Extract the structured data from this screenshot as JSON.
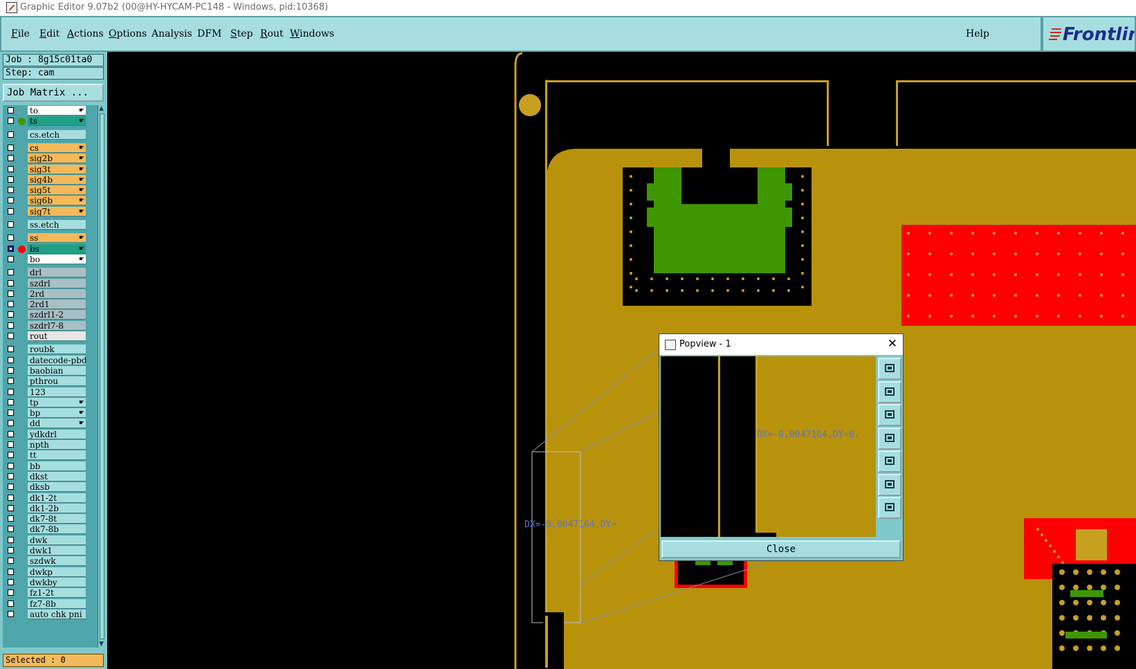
{
  "window": {
    "title": "Graphic Editor 9.07b2 (00@HY-HYCAM-PC148 - Windows, pid:10368)"
  },
  "menu": {
    "items": [
      {
        "label": "File",
        "hot": "F",
        "rest": "ile"
      },
      {
        "label": "Edit",
        "hot": "E",
        "rest": "dit"
      },
      {
        "label": "Actions",
        "hot": "A",
        "rest": "ctions"
      },
      {
        "label": "Options",
        "hot": "O",
        "rest": "ptions"
      },
      {
        "label": "Analysis",
        "hot": "",
        "rest": "Analysis"
      },
      {
        "label": "DFM",
        "hot": "",
        "rest": "DFM"
      },
      {
        "label": "Step",
        "hot": "S",
        "rest": "tep"
      },
      {
        "label": "Rout",
        "hot": "R",
        "rest": "out"
      },
      {
        "label": "Windows",
        "hot": "W",
        "rest": "indows"
      }
    ],
    "help": "Help"
  },
  "logo": {
    "text": "Frontline"
  },
  "sidebar": {
    "job": "Job : 8g15c01ta0",
    "step": "Step: cam",
    "matrix_button": "Job Matrix ...",
    "selected": "Selected : 0"
  },
  "colors": {
    "board": "#b8920b",
    "solder_mask": "#ff0000",
    "pad_green": "#3e9600",
    "outline": "#c8a020",
    "highlight_white": "#ffffff",
    "highlight_teal": "#1fa188",
    "highlight_orange": "#f4b95a",
    "highlight_gray": "#a8bfc3",
    "highlight_cyan": "#a6dee0"
  },
  "layers": [
    {
      "name": "to",
      "bg": "#ffffff",
      "mark": "☛",
      "group": 0
    },
    {
      "name": "ts",
      "bg": "#1fa188",
      "mark": "☛",
      "dot": "#3e9600",
      "group": 0
    },
    {
      "name": "cs.etch",
      "bg": "#a6dee0",
      "mark": "",
      "group": 1
    },
    {
      "name": "cs",
      "bg": "#f4b95a",
      "mark": "☛",
      "group": 2
    },
    {
      "name": "sig2b",
      "bg": "#f4b95a",
      "mark": "☛",
      "group": 2
    },
    {
      "name": "sig3t",
      "bg": "#f4b95a",
      "mark": "☛",
      "group": 2
    },
    {
      "name": "sig4b",
      "bg": "#f4b95a",
      "mark": "☛",
      "group": 2
    },
    {
      "name": "sig5t",
      "bg": "#f4b95a",
      "mark": "☛",
      "group": 2
    },
    {
      "name": "sig6b",
      "bg": "#f4b95a",
      "mark": "☛",
      "group": 2
    },
    {
      "name": "sig7t",
      "bg": "#f4b95a",
      "mark": "☛",
      "group": 2
    },
    {
      "name": "ss.etch",
      "bg": "#a6dee0",
      "mark": "",
      "group": 3
    },
    {
      "name": "ss",
      "bg": "#f4b95a",
      "mark": "☛",
      "group": 4
    },
    {
      "name": "bs",
      "bg": "#1fa188",
      "mark": "☛",
      "dot": "#ff0000",
      "selected": true,
      "group": 4
    },
    {
      "name": "bo",
      "bg": "#ffffff",
      "mark": "☛",
      "group": 4
    },
    {
      "name": "drl",
      "bg": "#a8bfc3",
      "mark": "",
      "group": 5
    },
    {
      "name": "szdrl",
      "bg": "#a8bfc3",
      "mark": "",
      "group": 5
    },
    {
      "name": "2rd",
      "bg": "#a8bfc3",
      "mark": "",
      "group": 5
    },
    {
      "name": "2rd1",
      "bg": "#a8bfc3",
      "mark": "",
      "group": 5
    },
    {
      "name": "szdrl1-2",
      "bg": "#a8bfc3",
      "mark": "",
      "group": 5
    },
    {
      "name": "szdrl7-8",
      "bg": "#a8bfc3",
      "mark": "",
      "group": 5
    },
    {
      "name": "rout",
      "bg": "#e6e6e6",
      "mark": "",
      "group": 5
    },
    {
      "name": "roubk",
      "bg": "#a6dee0",
      "mark": "",
      "group": 6
    },
    {
      "name": "datecode-pbd",
      "bg": "#a6dee0",
      "mark": "",
      "group": 6
    },
    {
      "name": "baobian",
      "bg": "#a6dee0",
      "mark": "",
      "group": 6
    },
    {
      "name": "pthrou",
      "bg": "#a6dee0",
      "mark": "",
      "group": 6
    },
    {
      "name": "123",
      "bg": "#a6dee0",
      "mark": "",
      "group": 6
    },
    {
      "name": "tp",
      "bg": "#a6dee0",
      "mark": "☛",
      "group": 6
    },
    {
      "name": "bp",
      "bg": "#a6dee0",
      "mark": "☛",
      "group": 6
    },
    {
      "name": "dd",
      "bg": "#a6dee0",
      "mark": "☛",
      "group": 6
    },
    {
      "name": "ydkdrl",
      "bg": "#a6dee0",
      "mark": "",
      "group": 6
    },
    {
      "name": "npth",
      "bg": "#a6dee0",
      "mark": "",
      "group": 6
    },
    {
      "name": "tt",
      "bg": "#a6dee0",
      "mark": "",
      "group": 6
    },
    {
      "name": "bb",
      "bg": "#a6dee0",
      "mark": "",
      "group": 6
    },
    {
      "name": "dkst",
      "bg": "#a6dee0",
      "mark": "",
      "group": 6
    },
    {
      "name": "dksb",
      "bg": "#a6dee0",
      "mark": "",
      "group": 6
    },
    {
      "name": "dk1-2t",
      "bg": "#a6dee0",
      "mark": "",
      "group": 6
    },
    {
      "name": "dk1-2b",
      "bg": "#a6dee0",
      "mark": "",
      "group": 6
    },
    {
      "name": "dk7-8t",
      "bg": "#a6dee0",
      "mark": "",
      "group": 6
    },
    {
      "name": "dk7-8b",
      "bg": "#a6dee0",
      "mark": "",
      "group": 6
    },
    {
      "name": "dwk",
      "bg": "#a6dee0",
      "mark": "",
      "group": 6
    },
    {
      "name": "dwk1",
      "bg": "#a6dee0",
      "mark": "",
      "group": 6
    },
    {
      "name": "szdwk",
      "bg": "#a6dee0",
      "mark": "",
      "group": 6
    },
    {
      "name": "dwkp",
      "bg": "#a6dee0",
      "mark": "",
      "group": 6
    },
    {
      "name": "dwkby",
      "bg": "#a6dee0",
      "mark": "",
      "group": 6
    },
    {
      "name": "fz1-2t",
      "bg": "#a6dee0",
      "mark": "",
      "group": 6
    },
    {
      "name": "fz7-8b",
      "bg": "#a6dee0",
      "mark": "",
      "group": 6
    },
    {
      "name": "auto chk pni",
      "bg": "#a6dee0",
      "mark": "",
      "group": 6
    }
  ],
  "canvas": {
    "measure_label": "DX=-0.0047164,DY="
  },
  "popview": {
    "title": "Popview - 1",
    "measure_label": "DX=-0.0047164,DY=0.",
    "close_label": "Close",
    "tools": [
      "zoom-fit-icon",
      "pan-up-icon",
      "pan-down-icon",
      "pan-left-icon",
      "pan-right-icon",
      "zoom-in-icon",
      "zoom-out-icon"
    ]
  }
}
